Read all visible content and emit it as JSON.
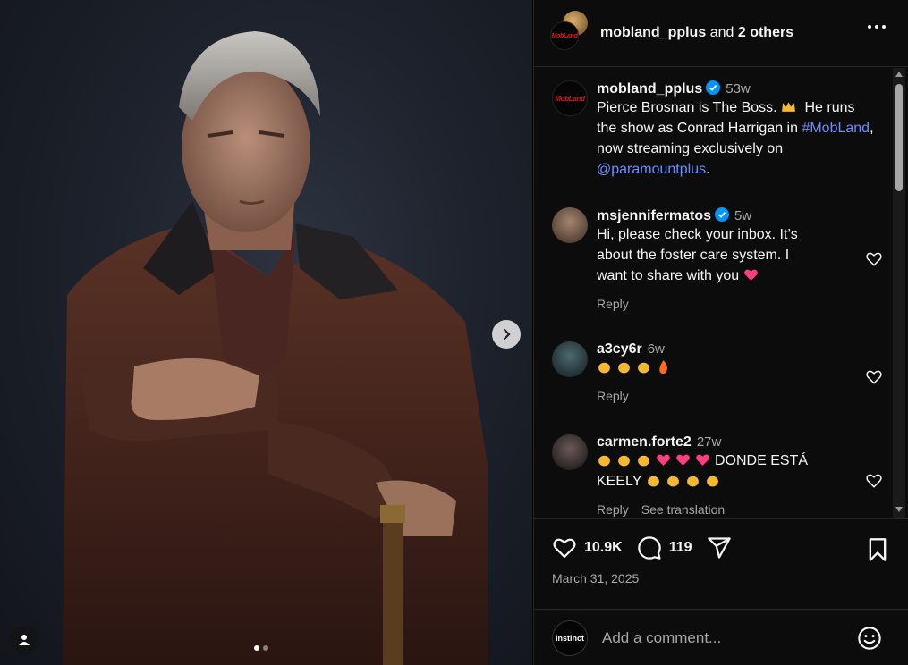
{
  "header": {
    "username": "mobland_pplus",
    "and_text": "and",
    "others": "2 others",
    "logo_text": "MobLand"
  },
  "caption": {
    "username": "mobland_pplus",
    "age": "53w",
    "text_part1": "Pierce Brosnan is The Boss. ",
    "text_part2": " He runs the show as Conrad Harrigan in ",
    "hashtag": "#MobLand",
    "text_part3": ", now streaming exclusively on ",
    "mention": "@paramountplus",
    "text_part4": "."
  },
  "comments": [
    {
      "username": "msjennifermatos",
      "age": "5w",
      "text": "Hi, please check your inbox. It’s about the foster care system. I want to share with you",
      "reply": "Reply"
    },
    {
      "username": "a3cy6r",
      "age": "6w",
      "reply": "Reply"
    },
    {
      "username": "carmen.forte2",
      "age": "27w",
      "text_a": "DONDE ESTÁ",
      "text_b": "KEELY",
      "reply": "Reply",
      "see_translation": "See translation"
    }
  ],
  "actions": {
    "likes": "10.9K",
    "comments": "119",
    "date": "March 31, 2025"
  },
  "comment_bar": {
    "placeholder": "Add a comment...",
    "avatar_text": "instinct"
  },
  "colors": {
    "link": "#6d8dff",
    "verified": "#0095f6",
    "heart_emoji": "#ff3e7f",
    "brand_red": "#e0141a"
  },
  "icons": [
    "next-arrow-icon",
    "user-tag-icon",
    "more-icon",
    "verified-icon",
    "heart-icon",
    "comment-icon",
    "share-icon",
    "bookmark-icon",
    "emoji-icon"
  ]
}
